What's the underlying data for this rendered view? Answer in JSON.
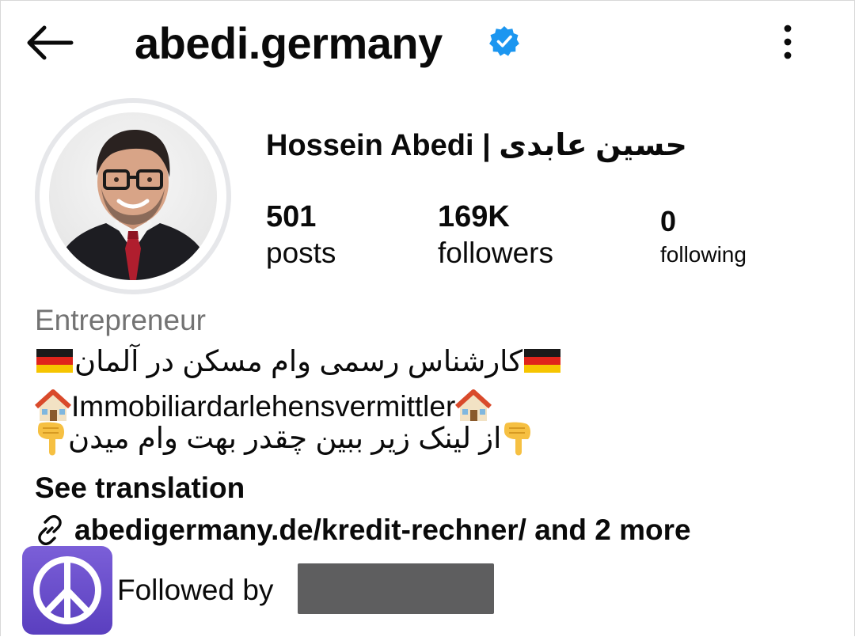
{
  "header": {
    "username": "abedi.germany",
    "verified": true,
    "icons": [
      "back-arrow-icon",
      "verified-badge-icon",
      "more-vertical-icon"
    ]
  },
  "profile": {
    "full_name": "Hossein Abedi | حسین عابدی",
    "avatar_icon": "profile-photo",
    "stats": {
      "posts_count": "501",
      "posts_label": "posts",
      "followers_count": "169K",
      "followers_label": "followers",
      "following_count": "0",
      "following_label": "following"
    },
    "category": "Entrepreneur",
    "bio": {
      "line1_text": "کارشناس رسمی وام مسکن در آلمان",
      "line1_emoji": "germany-flag-icon",
      "line2_text": "Immobiliardarlehensvermittler",
      "line2_emoji": "house-icon",
      "line3_text": "از لینک زیر ببین چقدر بهت وام میدن",
      "line3_emoji": "pointing-down-icon"
    },
    "see_translation": "See translation",
    "link": {
      "icon": "link-icon",
      "text": "abedigermany.de/kredit-rechner/ and 2 more"
    },
    "followed_by": {
      "label": "Followed by",
      "avatar_icon": "peace-sign-icon"
    }
  },
  "colors": {
    "verified_blue": "#1c96f0",
    "secondary_text": "#737373",
    "avatar_ring": "#e6e7ea",
    "follower_avatar_bg": "#6a4cc9",
    "redaction": "#5e5e5f"
  }
}
